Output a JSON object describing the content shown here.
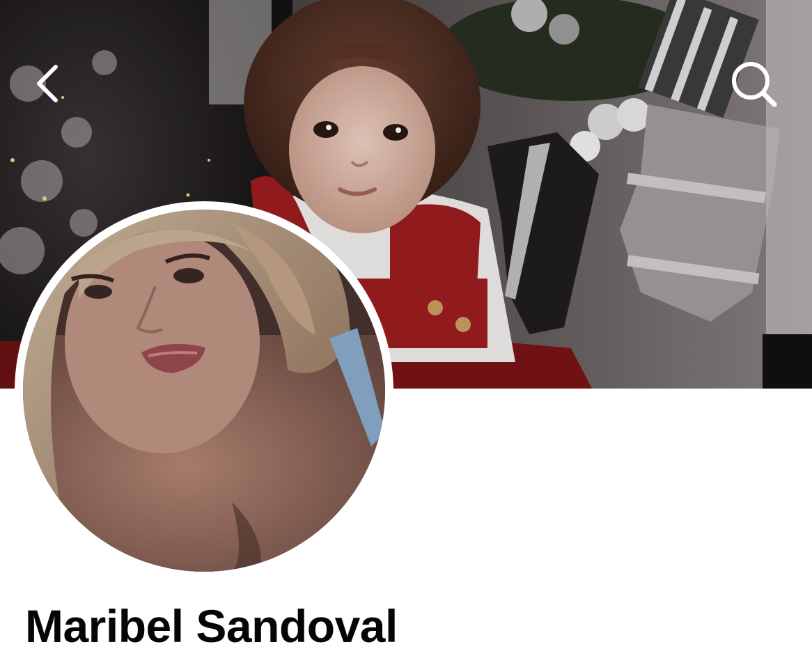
{
  "profile": {
    "name": "Maribel Sandoval"
  },
  "header": {
    "back_icon": "chevron-left-icon",
    "search_icon": "search-icon"
  },
  "colors": {
    "background": "#ffffff",
    "name_text": "#050505",
    "icon": "#ffffff"
  }
}
